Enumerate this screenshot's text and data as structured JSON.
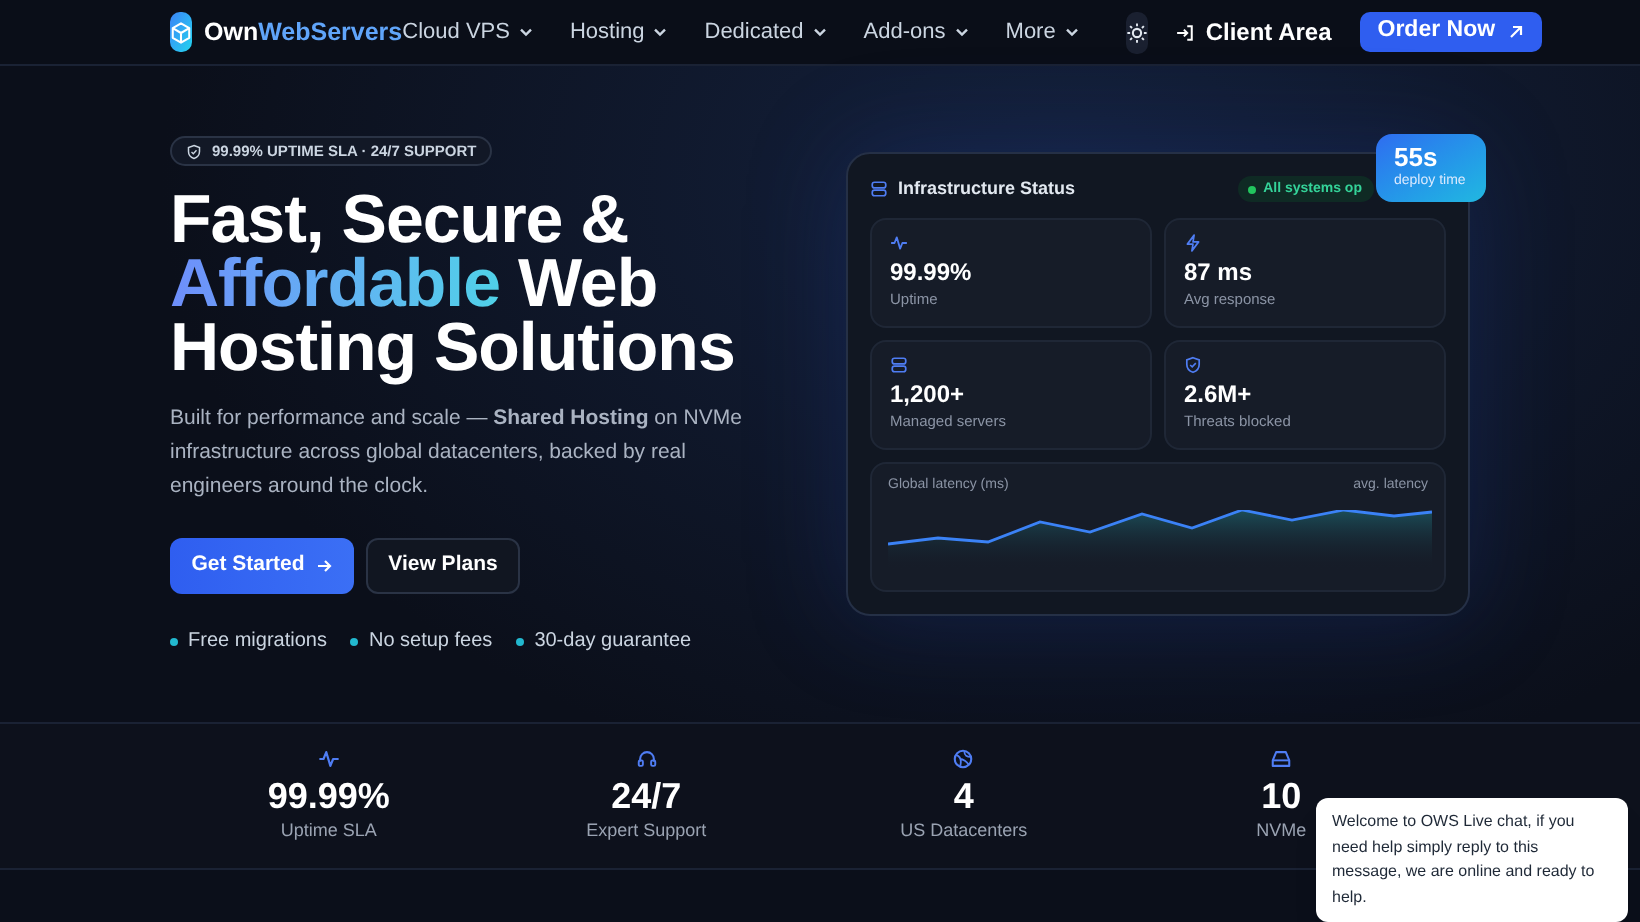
{
  "nav": {
    "brand_first": "Own",
    "brand_second": "WebServers",
    "menu": [
      {
        "label": "Cloud VPS"
      },
      {
        "label": "Hosting"
      },
      {
        "label": "Dedicated"
      },
      {
        "label": "Add-ons"
      },
      {
        "label": "More"
      }
    ],
    "client_area": "Client Area",
    "order": "Order Now"
  },
  "hero": {
    "badge": "99.99% UPTIME SLA · 24/7 SUPPORT",
    "title_line1": "Fast, Secure &",
    "title_accent": "Affordable",
    "title_rest": " Web",
    "title_line3": "Hosting Solutions",
    "description": "Built for performance and scale — **Shared Hosting** on NVMe infrastructure across global datacenters, backed by real engineers around the clock.",
    "primary_button": "Get Started",
    "secondary_button": "View Plans",
    "features": [
      "Free migrations",
      "No setup fees",
      "30-day guarantee"
    ]
  },
  "status_card": {
    "title": "Infrastructure Status",
    "status": "All systems op",
    "deploy_value": "55s",
    "deploy_label": "deploy time",
    "metrics": [
      {
        "kind": "pulse",
        "value": "99.99%",
        "label": "Uptime"
      },
      {
        "kind": "bolt",
        "value": "87 ms",
        "label": "Avg response"
      },
      {
        "kind": "server",
        "value": "1,200+",
        "label": "Managed servers"
      },
      {
        "kind": "shield",
        "value": "2.6M+",
        "label": "Threats blocked"
      }
    ],
    "latency_title": "Global latency (ms)",
    "latency_legend": "avg. latency"
  },
  "stats": [
    {
      "kind": "pulse",
      "value": "99.99%",
      "label": "Uptime SLA"
    },
    {
      "kind": "headset",
      "value": "24/7",
      "label": "Expert Support"
    },
    {
      "kind": "globe",
      "value": "4",
      "label": "US Datacenters"
    },
    {
      "kind": "drive",
      "value": "10",
      "label": "NVMe"
    }
  ],
  "chat": {
    "message": "Welcome to OWS Live chat, if you need help simply reply to this message, we are online and ready to help."
  }
}
